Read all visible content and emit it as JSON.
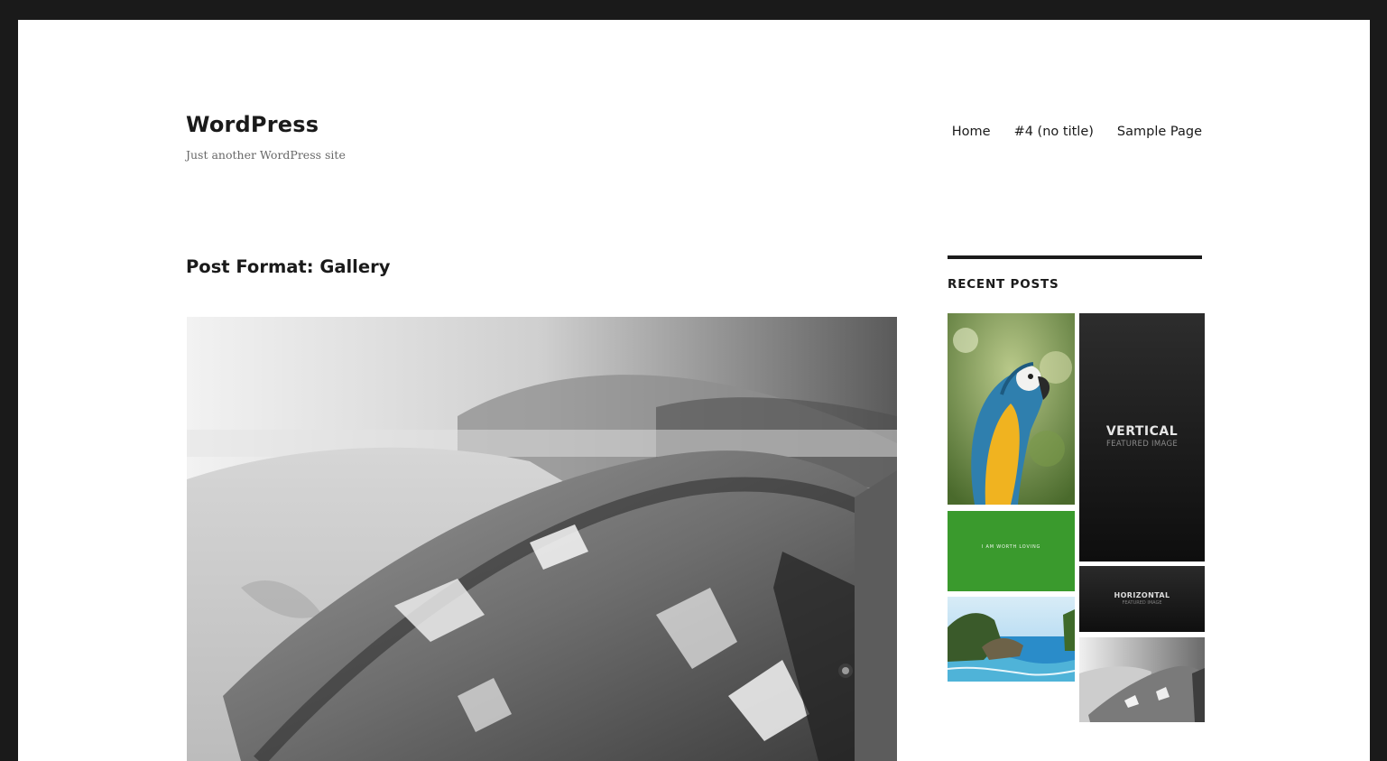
{
  "site": {
    "title": "WordPress",
    "description": "Just another WordPress site"
  },
  "nav": {
    "items": [
      "Home",
      "#4 (no title)",
      "Sample Page"
    ]
  },
  "main": {
    "page_title": "Post Format: Gallery"
  },
  "sidebar": {
    "widget_title": "RECENT POSTS",
    "thumbnails": {
      "vertical": {
        "line1": "VERTICAL",
        "line2": "FEATURED IMAGE"
      },
      "horizontal": {
        "line1": "HORIZONTAL",
        "line2": "FEATURED IMAGE"
      },
      "green": {
        "text": "I AM WORTH LOVING"
      }
    }
  },
  "colors": {
    "frame": "#1a1a1a",
    "background": "#ffffff",
    "text": "#1a1a1a",
    "muted": "#686868",
    "green_thumb": "#3a9a2d"
  }
}
